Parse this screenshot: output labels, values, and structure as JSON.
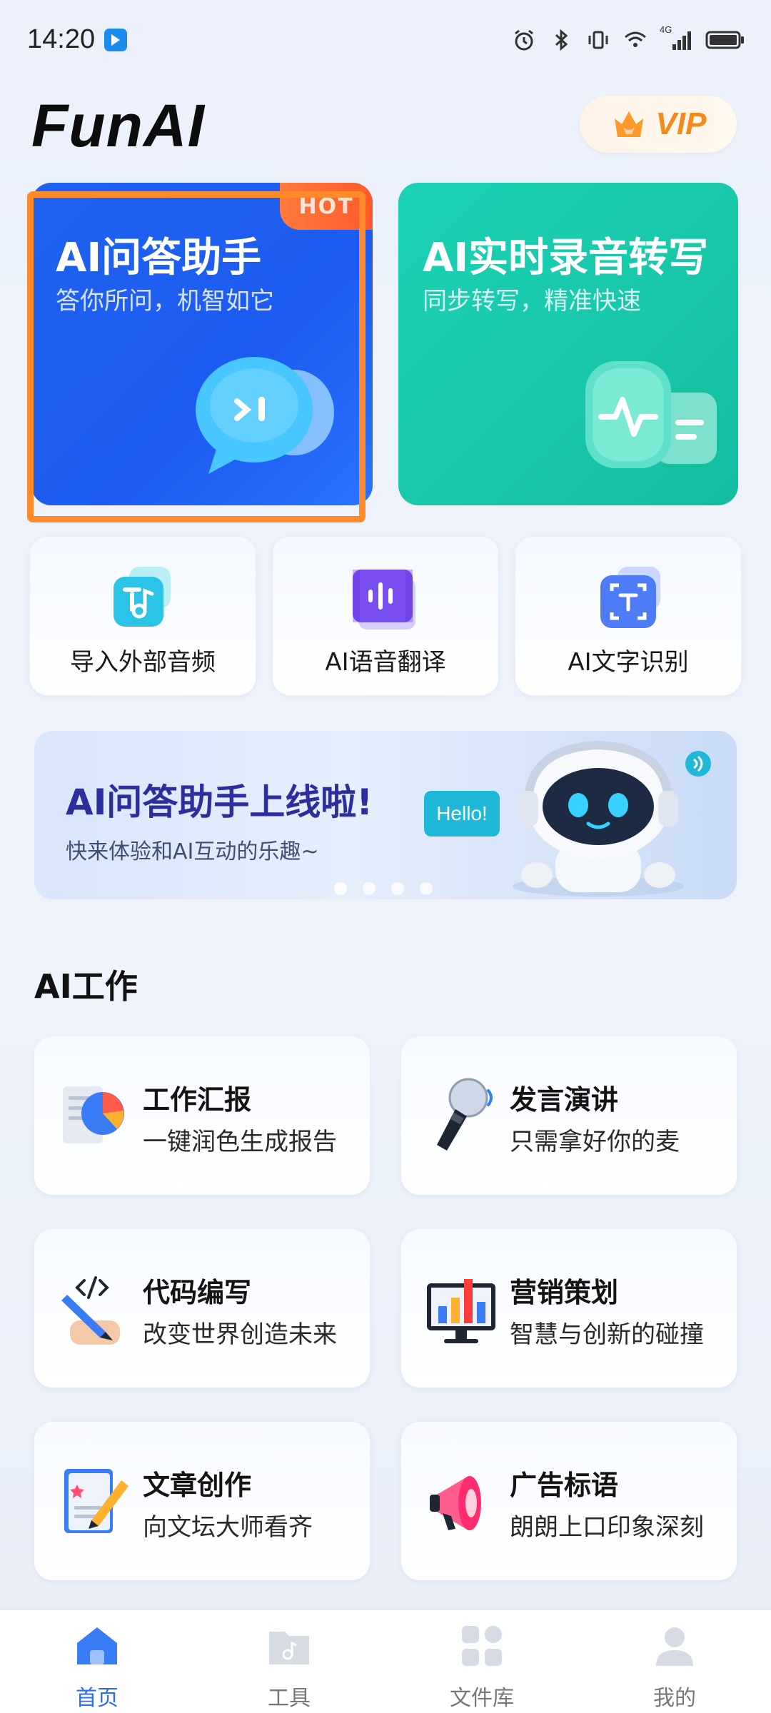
{
  "status": {
    "time": "14:20",
    "app_badge_icon": "app-notification-icon",
    "signal_label": "4G",
    "icons": [
      "alarm-icon",
      "bluetooth-icon",
      "vibrate-icon",
      "wifi-icon",
      "cellular-signal-icon",
      "battery-icon"
    ]
  },
  "header": {
    "brand": "FunAI",
    "vip_label": "VIP"
  },
  "hero": {
    "qa": {
      "title": "AI问答助手",
      "subtitle": "答你所问，机智如它",
      "badge": "HOT"
    },
    "rec": {
      "title": "AI实时录音转写",
      "subtitle": "同步转写，精准快速"
    }
  },
  "tools": [
    {
      "label": "导入外部音频",
      "icon": "music-import-icon"
    },
    {
      "label": "AI语音翻译",
      "icon": "voice-wave-icon"
    },
    {
      "label": "AI文字识别",
      "icon": "text-scan-icon"
    }
  ],
  "banner": {
    "title": "AI问答助手上线啦!",
    "subtitle": "快来体验和AI互动的乐趣~",
    "bubble": "Hello!",
    "page_count": 4,
    "active_page": 1
  },
  "section": {
    "title": "AI工作"
  },
  "work": [
    {
      "title": "工作汇报",
      "subtitle": "一键润色生成报告",
      "icon": "report-chart-icon"
    },
    {
      "title": "发言演讲",
      "subtitle": "只需拿好你的麦",
      "icon": "microphone-icon"
    },
    {
      "title": "代码编写",
      "subtitle": "改变世界创造未来",
      "icon": "code-pen-icon"
    },
    {
      "title": "营销策划",
      "subtitle": "智慧与创新的碰撞",
      "icon": "marketing-monitor-icon"
    },
    {
      "title": "文章创作",
      "subtitle": "向文坛大师看齐",
      "icon": "article-write-icon"
    },
    {
      "title": "广告标语",
      "subtitle": "朗朗上口印象深刻",
      "icon": "megaphone-icon"
    }
  ],
  "nav": [
    {
      "label": "首页",
      "icon": "home-icon",
      "active": true
    },
    {
      "label": "工具",
      "icon": "tools-folder-icon",
      "active": false
    },
    {
      "label": "文件库",
      "icon": "file-library-icon",
      "active": false
    },
    {
      "label": "我的",
      "icon": "profile-icon",
      "active": false
    }
  ],
  "colors": {
    "qa_blue": "#1f62f0",
    "rec_teal": "#18c7a8",
    "hot_orange": "#ff5a2c",
    "highlight_orange": "#ff8a2a",
    "vip_orange": "#f28b1c",
    "nav_active": "#2b6cf2",
    "banner_title": "#2a2f9c"
  }
}
